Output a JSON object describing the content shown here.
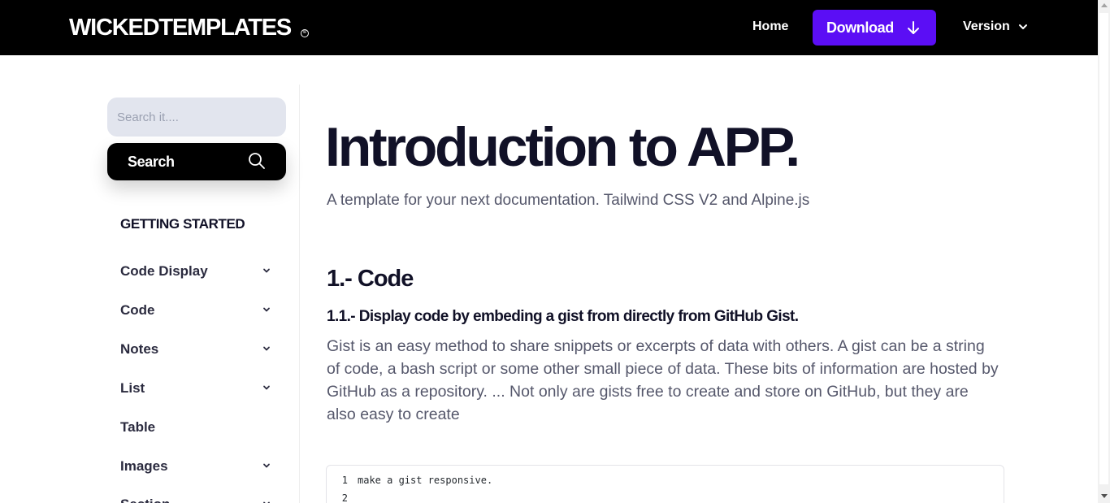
{
  "header": {
    "brand": "WICKEDTEMPLATES",
    "brand_mark": "©",
    "nav_home": "Home",
    "download_label": "Download",
    "version_label": "Version",
    "accent_color": "#5b0ef5"
  },
  "sidebar": {
    "search_placeholder": "Search it....",
    "search_button": "Search",
    "heading": "GETTING STARTED",
    "items": [
      {
        "label": "Code Display",
        "has_submenu": true
      },
      {
        "label": "Code",
        "has_submenu": true
      },
      {
        "label": "Notes",
        "has_submenu": true
      },
      {
        "label": "List",
        "has_submenu": true
      },
      {
        "label": "Table",
        "has_submenu": false
      },
      {
        "label": "Images",
        "has_submenu": true
      },
      {
        "label": "Section",
        "has_submenu": true
      }
    ]
  },
  "main": {
    "title": "Introduction to APP.",
    "subtitle": "A template for your next documentation. Tailwind CSS V2 and Alpine.js",
    "section_heading": "1.- Code",
    "subsection_heading": "1.1.- Display code by embeding a gist from directly from GitHub Gist.",
    "paragraph": "Gist is an easy method to share snippets or excerpts of data with others. A gist can be a string of code, a bash script or some other small piece of data. These bits of information are hosted by GitHub as a repository. ... Not only are gists free to create and store on GitHub, but they are also easy to create",
    "code_lines": [
      {
        "num": "1",
        "text": "make a gist responsive."
      },
      {
        "num": "2",
        "text": ""
      }
    ]
  }
}
